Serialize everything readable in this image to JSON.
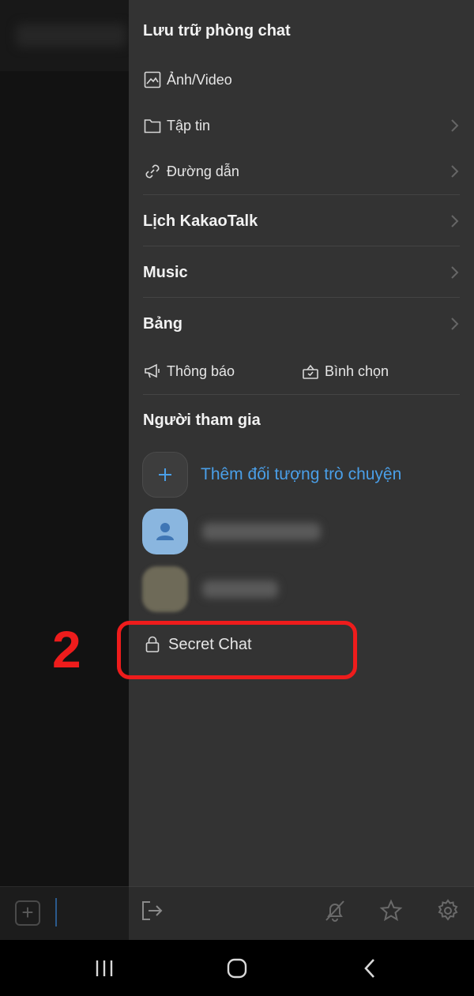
{
  "drawer": {
    "archive_title": "Lưu trữ phòng chat",
    "archive_items": [
      {
        "label": "Ảnh/Video",
        "icon": "image-icon"
      },
      {
        "label": "Tập tin",
        "icon": "folder-icon"
      },
      {
        "label": "Đường dẫn",
        "icon": "link-icon"
      }
    ],
    "calendar_label": "Lịch KakaoTalk",
    "music_label": "Music",
    "board_label": "Bảng",
    "notice_label": "Thông báo",
    "poll_label": "Bình chọn",
    "participants_title": "Người tham gia",
    "invite_label": "Thêm đối tượng trò chuyện",
    "secret_chat_label": "Secret Chat"
  },
  "annotation": {
    "step_number": "2",
    "color": "#ee1c1c"
  },
  "colors": {
    "accent": "#4a9fe8",
    "drawer_bg": "#333333"
  }
}
